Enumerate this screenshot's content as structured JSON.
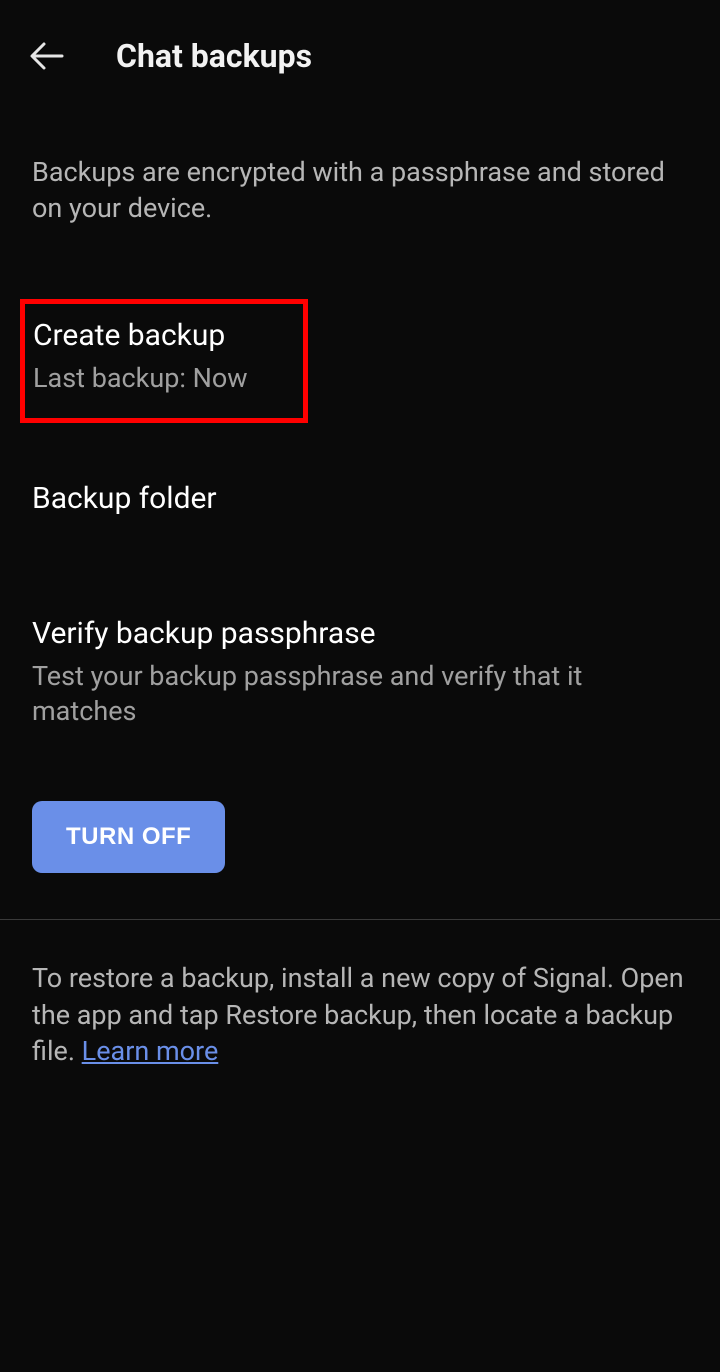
{
  "header": {
    "title": "Chat backups"
  },
  "description": "Backups are encrypted with a passphrase and stored on your device.",
  "items": {
    "create_backup": {
      "title": "Create backup",
      "subtitle": "Last backup: Now"
    },
    "backup_folder": {
      "title": "Backup folder"
    },
    "verify_passphrase": {
      "title": "Verify backup passphrase",
      "subtitle": "Test your backup passphrase and verify that it matches"
    }
  },
  "button": {
    "turn_off": "TURN OFF"
  },
  "footer": {
    "text": "To restore a backup, install a new copy of Signal. Open the app and tap Restore backup, then locate a backup file. ",
    "link": "Learn more"
  }
}
